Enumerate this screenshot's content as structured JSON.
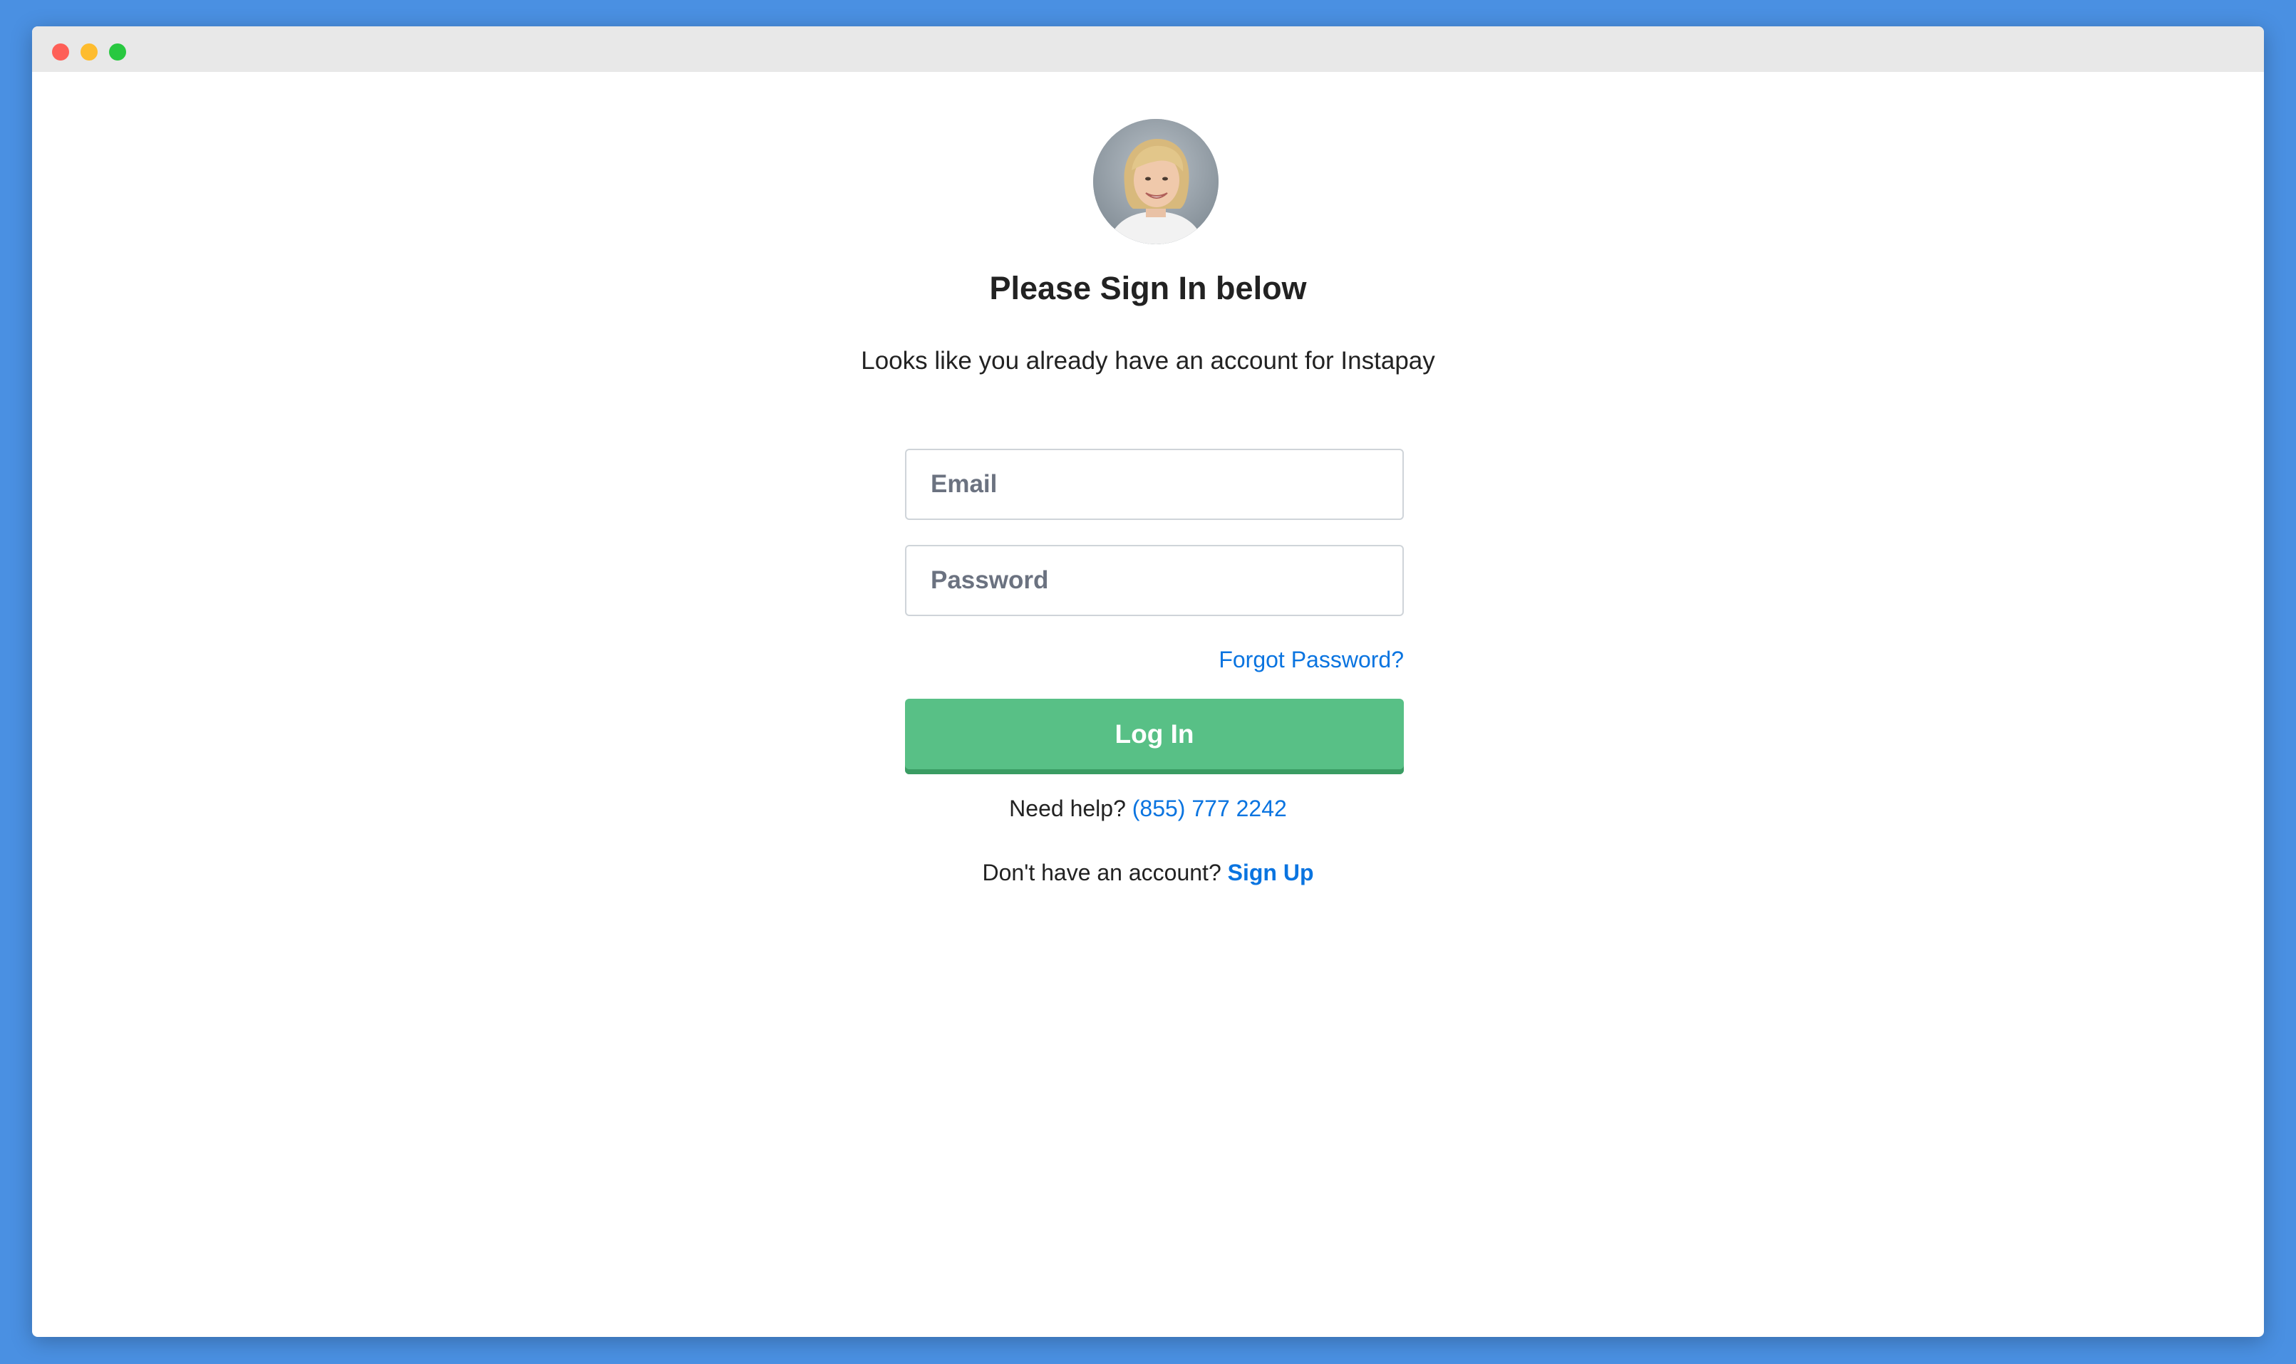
{
  "window": {
    "controls": [
      "close",
      "minimize",
      "zoom"
    ]
  },
  "colors": {
    "background": "#4a90e2",
    "accent": "#0a74e0",
    "button": "#58c086"
  },
  "avatar": {
    "icon": "user-avatar-photo"
  },
  "signin": {
    "heading": "Please Sign In below",
    "subtext": "Looks like you already have an account for Instapay",
    "email_placeholder": "Email",
    "password_placeholder": "Password",
    "forgot_label": "Forgot Password?",
    "login_label": "Log In",
    "help_text": "Need help?",
    "help_phone": "(855) 777 2242",
    "signup_text": "Don't have an account?",
    "signup_link": "Sign Up"
  }
}
